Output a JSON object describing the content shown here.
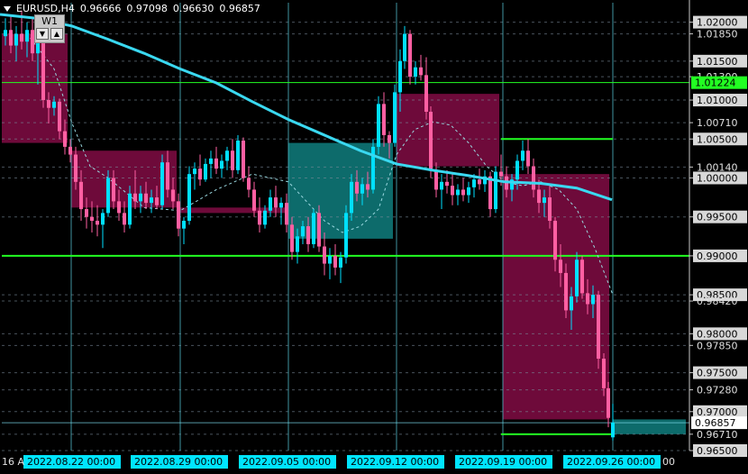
{
  "header": {
    "symbol": "EURUSD,H4",
    "open": "0.96666",
    "high": "0.97098",
    "low": "0.96630",
    "close": "0.96857"
  },
  "widget": {
    "label": "W1"
  },
  "colors": {
    "bull": "#00e0ff",
    "bear": "#ff5fa2",
    "ma": "#3ad8f0",
    "box_bear": "#6e0a3a",
    "box_bull": "#0d6b6b",
    "hline": "#22ff22",
    "grid": "#7a8b9a",
    "vline": "#4fb8c8",
    "current": "#7ad8e8"
  },
  "chart_data": {
    "type": "candlestick",
    "ylim": [
      0.965,
      1.0225
    ],
    "price_labels": [
      "1.02000",
      "1.01850",
      "1.01500",
      "1.01300",
      "1.01000",
      "1.00710",
      "1.00500",
      "1.00140",
      "1.00000",
      "0.99500",
      "0.99000",
      "0.98500",
      "0.98420",
      "0.98000",
      "0.97850",
      "0.97500",
      "0.97280",
      "0.97000",
      "0.96710",
      "0.96500"
    ],
    "horizontal_lines": [
      {
        "price": 1.01224,
        "label": "1.01224"
      },
      {
        "price": 0.99,
        "label": "0.99000"
      },
      {
        "price": 0.96857,
        "label": "0.96857"
      }
    ],
    "date_labels": [
      "2022.08.22 00:00",
      "2022.08.29 00:00",
      "2022.09.05 00:00",
      "2022.09.12 00:00",
      "2022.09.19 00:00",
      "2022.09.26 00:00"
    ],
    "edge_labels": [
      "16 A",
      "00"
    ],
    "weekly_boxes": [
      {
        "week": "2022.08.15",
        "open": 1.0185,
        "close": 1.0045,
        "type": "bear"
      },
      {
        "week": "2022.08.22",
        "open": 1.0035,
        "close": 0.9962,
        "type": "bear"
      },
      {
        "week": "2022.08.29",
        "open": 0.9962,
        "close": 0.9955,
        "type": "bear"
      },
      {
        "week": "2022.09.05",
        "open": 0.9922,
        "close": 1.0045,
        "type": "bull"
      },
      {
        "week": "2022.09.12",
        "open": 1.0108,
        "close": 1.0015,
        "type": "bear"
      },
      {
        "week": "2022.09.19",
        "open": 1.0005,
        "close": 0.969,
        "type": "bear"
      },
      {
        "week": "2022.09.26",
        "open": 0.969,
        "close": 0.9671,
        "type": "bull"
      }
    ],
    "green_segments": [
      {
        "price": 1.005,
        "from": "2022.09.19",
        "to": "2022.09.26"
      },
      {
        "price": 0.9671,
        "from": "2022.09.19",
        "to": "2022.09.26"
      }
    ],
    "ma_series": [
      [
        0,
        1.021
      ],
      [
        40,
        1.0205
      ],
      [
        80,
        1.0195
      ],
      [
        120,
        1.0178
      ],
      [
        160,
        1.016
      ],
      [
        200,
        1.014
      ],
      [
        240,
        1.0122
      ],
      [
        280,
        1.0098
      ],
      [
        320,
        1.0075
      ],
      [
        360,
        1.0055
      ],
      [
        400,
        1.0035
      ],
      [
        440,
        1.0018
      ],
      [
        480,
        1.001
      ],
      [
        520,
        1.0003
      ],
      [
        560,
        0.9995
      ],
      [
        600,
        0.9993
      ],
      [
        640,
        0.9987
      ],
      [
        679,
        0.9972
      ]
    ],
    "dashed_ma_series": [
      [
        30,
        1.0185
      ],
      [
        60,
        1.014
      ],
      [
        80,
        1.007
      ],
      [
        100,
        1.0015
      ],
      [
        120,
        1.0
      ],
      [
        160,
        0.9962
      ],
      [
        200,
        0.9958
      ],
      [
        240,
        0.9985
      ],
      [
        280,
        1.0005
      ],
      [
        320,
        0.9995
      ],
      [
        360,
        0.9945
      ],
      [
        380,
        0.993
      ],
      [
        400,
        0.9938
      ],
      [
        420,
        0.996
      ],
      [
        440,
        1.003
      ],
      [
        460,
        1.0062
      ],
      [
        480,
        1.0072
      ],
      [
        500,
        1.0068
      ],
      [
        520,
        1.0045
      ],
      [
        540,
        1.0015
      ],
      [
        560,
        0.9995
      ],
      [
        580,
        0.999
      ],
      [
        600,
        0.9995
      ],
      [
        620,
        0.9985
      ],
      [
        640,
        0.996
      ],
      [
        660,
        0.991
      ],
      [
        680,
        0.985
      ]
    ],
    "candles": [
      {
        "x": 6,
        "o": 1.0182,
        "h": 1.0205,
        "l": 1.017,
        "c": 1.019
      },
      {
        "x": 12,
        "o": 1.019,
        "h": 1.021,
        "l": 1.016,
        "c": 1.017
      },
      {
        "x": 18,
        "o": 1.017,
        "h": 1.0195,
        "l": 1.015,
        "c": 1.0185
      },
      {
        "x": 24,
        "o": 1.0185,
        "h": 1.0215,
        "l": 1.0165,
        "c": 1.0175
      },
      {
        "x": 30,
        "o": 1.0175,
        "h": 1.02,
        "l": 1.0155,
        "c": 1.019
      },
      {
        "x": 36,
        "o": 1.019,
        "h": 1.0205,
        "l": 1.015,
        "c": 1.016
      },
      {
        "x": 42,
        "o": 1.016,
        "h": 1.0185,
        "l": 1.012,
        "c": 1.0175
      },
      {
        "x": 48,
        "o": 1.0175,
        "h": 1.018,
        "l": 1.009,
        "c": 1.01
      },
      {
        "x": 54,
        "o": 1.01,
        "h": 1.011,
        "l": 1.007,
        "c": 1.009
      },
      {
        "x": 60,
        "o": 1.009,
        "h": 1.0105,
        "l": 1.008,
        "c": 1.0098
      },
      {
        "x": 66,
        "o": 1.0098,
        "h": 1.0102,
        "l": 1.005,
        "c": 1.006
      },
      {
        "x": 72,
        "o": 1.006,
        "h": 1.0075,
        "l": 1.003,
        "c": 1.004
      },
      {
        "x": 78,
        "o": 1.004,
        "h": 1.005,
        "l": 1.002,
        "c": 1.003
      },
      {
        "x": 84,
        "o": 1.003,
        "h": 1.004,
        "l": 0.9985,
        "c": 0.9995
      },
      {
        "x": 90,
        "o": 0.9995,
        "h": 1.001,
        "l": 0.9945,
        "c": 0.996
      },
      {
        "x": 96,
        "o": 0.996,
        "h": 0.9975,
        "l": 0.9935,
        "c": 0.995
      },
      {
        "x": 102,
        "o": 0.995,
        "h": 0.997,
        "l": 0.993,
        "c": 0.9945
      },
      {
        "x": 108,
        "o": 0.9945,
        "h": 0.9965,
        "l": 0.9925,
        "c": 0.994
      },
      {
        "x": 114,
        "o": 0.994,
        "h": 0.996,
        "l": 0.991,
        "c": 0.9955
      },
      {
        "x": 120,
        "o": 0.9955,
        "h": 1.001,
        "l": 0.995,
        "c": 1.0
      },
      {
        "x": 126,
        "o": 1.0,
        "h": 1.001,
        "l": 0.996,
        "c": 0.997
      },
      {
        "x": 132,
        "o": 0.997,
        "h": 0.9985,
        "l": 0.9945,
        "c": 0.9955
      },
      {
        "x": 138,
        "o": 0.9955,
        "h": 0.997,
        "l": 0.993,
        "c": 0.994
      },
      {
        "x": 144,
        "o": 0.994,
        "h": 0.999,
        "l": 0.9935,
        "c": 0.998
      },
      {
        "x": 150,
        "o": 0.998,
        "h": 1.001,
        "l": 0.996,
        "c": 0.997
      },
      {
        "x": 156,
        "o": 0.997,
        "h": 0.999,
        "l": 0.9955,
        "c": 0.998
      },
      {
        "x": 162,
        "o": 0.998,
        "h": 0.9995,
        "l": 0.996,
        "c": 0.9968
      },
      {
        "x": 168,
        "o": 0.9968,
        "h": 0.9985,
        "l": 0.9955,
        "c": 0.9975
      },
      {
        "x": 174,
        "o": 0.9975,
        "h": 0.999,
        "l": 0.996,
        "c": 0.9965
      },
      {
        "x": 180,
        "o": 0.9965,
        "h": 1.003,
        "l": 0.996,
        "c": 1.002
      },
      {
        "x": 186,
        "o": 1.002,
        "h": 1.0035,
        "l": 0.9975,
        "c": 0.9985
      },
      {
        "x": 192,
        "o": 0.9985,
        "h": 1.0,
        "l": 0.996,
        "c": 0.997
      },
      {
        "x": 198,
        "o": 0.997,
        "h": 0.998,
        "l": 0.9925,
        "c": 0.9935
      },
      {
        "x": 204,
        "o": 0.9935,
        "h": 0.995,
        "l": 0.9915,
        "c": 0.9945
      },
      {
        "x": 210,
        "o": 0.9945,
        "h": 1.0015,
        "l": 0.994,
        "c": 1.0005
      },
      {
        "x": 216,
        "o": 1.0005,
        "h": 1.002,
        "l": 0.9985,
        "c": 1.0012
      },
      {
        "x": 222,
        "o": 1.0012,
        "h": 1.003,
        "l": 0.999,
        "c": 0.9998
      },
      {
        "x": 228,
        "o": 0.9998,
        "h": 1.0025,
        "l": 0.9995,
        "c": 1.0018
      },
      {
        "x": 234,
        "o": 1.0018,
        "h": 1.0035,
        "l": 1.0,
        "c": 1.0025
      },
      {
        "x": 240,
        "o": 1.0025,
        "h": 1.004,
        "l": 1.0005,
        "c": 1.0012
      },
      {
        "x": 246,
        "o": 1.0012,
        "h": 1.003,
        "l": 1.0,
        "c": 1.0022
      },
      {
        "x": 252,
        "o": 1.0022,
        "h": 1.004,
        "l": 1.001,
        "c": 1.0035
      },
      {
        "x": 258,
        "o": 1.0035,
        "h": 1.005,
        "l": 1.0,
        "c": 1.001
      },
      {
        "x": 264,
        "o": 1.001,
        "h": 1.0055,
        "l": 1.0005,
        "c": 1.0048
      },
      {
        "x": 270,
        "o": 1.0048,
        "h": 1.0052,
        "l": 0.9995,
        "c": 1.0
      },
      {
        "x": 276,
        "o": 1.0,
        "h": 1.0015,
        "l": 0.9975,
        "c": 0.9985
      },
      {
        "x": 282,
        "o": 0.9985,
        "h": 0.9995,
        "l": 0.995,
        "c": 0.9958
      },
      {
        "x": 288,
        "o": 0.9958,
        "h": 0.9975,
        "l": 0.993,
        "c": 0.994
      },
      {
        "x": 294,
        "o": 0.994,
        "h": 0.9965,
        "l": 0.9935,
        "c": 0.9958
      },
      {
        "x": 300,
        "o": 0.9958,
        "h": 0.9985,
        "l": 0.995,
        "c": 0.9975
      },
      {
        "x": 306,
        "o": 0.9975,
        "h": 0.999,
        "l": 0.995,
        "c": 0.9962
      },
      {
        "x": 312,
        "o": 0.9962,
        "h": 0.9975,
        "l": 0.994,
        "c": 0.9968
      },
      {
        "x": 318,
        "o": 0.9968,
        "h": 0.998,
        "l": 0.993,
        "c": 0.994
      },
      {
        "x": 324,
        "o": 0.994,
        "h": 0.995,
        "l": 0.9895,
        "c": 0.9905
      },
      {
        "x": 330,
        "o": 0.9905,
        "h": 0.9935,
        "l": 0.989,
        "c": 0.9925
      },
      {
        "x": 336,
        "o": 0.9925,
        "h": 0.9945,
        "l": 0.9915,
        "c": 0.9938
      },
      {
        "x": 342,
        "o": 0.9938,
        "h": 0.995,
        "l": 0.9905,
        "c": 0.9915
      },
      {
        "x": 348,
        "o": 0.9915,
        "h": 0.996,
        "l": 0.991,
        "c": 0.9955
      },
      {
        "x": 354,
        "o": 0.9955,
        "h": 0.9965,
        "l": 0.9905,
        "c": 0.9912
      },
      {
        "x": 360,
        "o": 0.9912,
        "h": 0.993,
        "l": 0.9875,
        "c": 0.989
      },
      {
        "x": 366,
        "o": 0.989,
        "h": 0.991,
        "l": 0.987,
        "c": 0.99
      },
      {
        "x": 372,
        "o": 0.99,
        "h": 0.9915,
        "l": 0.9875,
        "c": 0.9885
      },
      {
        "x": 378,
        "o": 0.9885,
        "h": 0.9905,
        "l": 0.9865,
        "c": 0.9898
      },
      {
        "x": 384,
        "o": 0.9898,
        "h": 0.9965,
        "l": 0.989,
        "c": 0.9955
      },
      {
        "x": 390,
        "o": 0.9955,
        "h": 1.0005,
        "l": 0.9945,
        "c": 0.9995
      },
      {
        "x": 396,
        "o": 0.9995,
        "h": 1.001,
        "l": 0.997,
        "c": 0.998
      },
      {
        "x": 402,
        "o": 0.998,
        "h": 1.0,
        "l": 0.9965,
        "c": 0.9992
      },
      {
        "x": 408,
        "o": 0.9992,
        "h": 1.0008,
        "l": 0.9975,
        "c": 0.9985
      },
      {
        "x": 414,
        "o": 0.9985,
        "h": 1.005,
        "l": 0.998,
        "c": 1.004
      },
      {
        "x": 420,
        "o": 1.004,
        "h": 1.0105,
        "l": 1.003,
        "c": 1.0095
      },
      {
        "x": 426,
        "o": 1.0095,
        "h": 1.011,
        "l": 1.004,
        "c": 1.0055
      },
      {
        "x": 432,
        "o": 1.0055,
        "h": 1.006,
        "l": 1.0025,
        "c": 1.0045
      },
      {
        "x": 438,
        "o": 1.0045,
        "h": 1.012,
        "l": 1.004,
        "c": 1.011
      },
      {
        "x": 444,
        "o": 1.011,
        "h": 1.0165,
        "l": 1.0085,
        "c": 1.015
      },
      {
        "x": 449,
        "o": 1.015,
        "h": 1.0195,
        "l": 1.014,
        "c": 1.0185
      },
      {
        "x": 455,
        "o": 1.0185,
        "h": 1.019,
        "l": 1.012,
        "c": 1.013
      },
      {
        "x": 461,
        "o": 1.013,
        "h": 1.015,
        "l": 1.012,
        "c": 1.0142
      },
      {
        "x": 467,
        "o": 1.0142,
        "h": 1.0158,
        "l": 1.0125,
        "c": 1.0132
      },
      {
        "x": 473,
        "o": 1.0132,
        "h": 1.0155,
        "l": 1.0075,
        "c": 1.0085
      },
      {
        "x": 478,
        "o": 1.0085,
        "h": 1.0092,
        "l": 1.0,
        "c": 1.001
      },
      {
        "x": 484,
        "o": 1.001,
        "h": 1.002,
        "l": 0.9975,
        "c": 0.9985
      },
      {
        "x": 490,
        "o": 0.9985,
        "h": 1.0005,
        "l": 0.996,
        "c": 0.9995
      },
      {
        "x": 496,
        "o": 0.9995,
        "h": 1.001,
        "l": 0.998,
        "c": 0.999
      },
      {
        "x": 502,
        "o": 0.999,
        "h": 1.0005,
        "l": 0.9965,
        "c": 0.9978
      },
      {
        "x": 508,
        "o": 0.9978,
        "h": 0.9992,
        "l": 0.9965,
        "c": 0.9985
      },
      {
        "x": 514,
        "o": 0.9985,
        "h": 1.0,
        "l": 0.997,
        "c": 0.9978
      },
      {
        "x": 520,
        "o": 0.9978,
        "h": 0.9995,
        "l": 0.9968,
        "c": 0.9988
      },
      {
        "x": 526,
        "o": 0.9988,
        "h": 1.0005,
        "l": 0.9975,
        "c": 0.9998
      },
      {
        "x": 532,
        "o": 0.9998,
        "h": 1.0012,
        "l": 0.9985,
        "c": 0.9992
      },
      {
        "x": 538,
        "o": 0.9992,
        "h": 1.001,
        "l": 0.9982,
        "c": 1.0002
      },
      {
        "x": 544,
        "o": 1.0002,
        "h": 1.0008,
        "l": 0.995,
        "c": 0.996
      },
      {
        "x": 550,
        "o": 0.996,
        "h": 1.0015,
        "l": 0.9955,
        "c": 1.0008
      },
      {
        "x": 556,
        "o": 1.0008,
        "h": 1.003,
        "l": 0.999,
        "c": 1.0002
      },
      {
        "x": 562,
        "o": 1.0002,
        "h": 1.0015,
        "l": 0.9975,
        "c": 0.9985
      },
      {
        "x": 568,
        "o": 0.9985,
        "h": 1.0005,
        "l": 0.997,
        "c": 0.9998
      },
      {
        "x": 574,
        "o": 0.9998,
        "h": 1.003,
        "l": 0.9985,
        "c": 1.0022
      },
      {
        "x": 580,
        "o": 1.0022,
        "h": 1.0048,
        "l": 1.001,
        "c": 1.0035
      },
      {
        "x": 586,
        "o": 1.0035,
        "h": 1.005,
        "l": 1.0005,
        "c": 1.0015
      },
      {
        "x": 592,
        "o": 1.0015,
        "h": 1.0025,
        "l": 0.9975,
        "c": 0.9985
      },
      {
        "x": 598,
        "o": 0.9985,
        "h": 0.9998,
        "l": 0.9955,
        "c": 0.9968
      },
      {
        "x": 604,
        "o": 0.9968,
        "h": 0.9985,
        "l": 0.995,
        "c": 0.9975
      },
      {
        "x": 610,
        "o": 0.9975,
        "h": 0.999,
        "l": 0.9935,
        "c": 0.9945
      },
      {
        "x": 616,
        "o": 0.9945,
        "h": 0.995,
        "l": 0.988,
        "c": 0.9895
      },
      {
        "x": 622,
        "o": 0.9895,
        "h": 0.9915,
        "l": 0.986,
        "c": 0.9878
      },
      {
        "x": 628,
        "o": 0.9878,
        "h": 0.989,
        "l": 0.982,
        "c": 0.983
      },
      {
        "x": 634,
        "o": 0.983,
        "h": 0.986,
        "l": 0.9805,
        "c": 0.9848
      },
      {
        "x": 640,
        "o": 0.9848,
        "h": 0.9905,
        "l": 0.984,
        "c": 0.9895
      },
      {
        "x": 646,
        "o": 0.9895,
        "h": 0.99,
        "l": 0.9845,
        "c": 0.9852
      },
      {
        "x": 652,
        "o": 0.9852,
        "h": 0.987,
        "l": 0.9825,
        "c": 0.9838
      },
      {
        "x": 658,
        "o": 0.9838,
        "h": 0.9862,
        "l": 0.982,
        "c": 0.985
      },
      {
        "x": 664,
        "o": 0.985,
        "h": 0.9855,
        "l": 0.9755,
        "c": 0.9768
      },
      {
        "x": 670,
        "o": 0.9768,
        "h": 0.9775,
        "l": 0.972,
        "c": 0.973
      },
      {
        "x": 675,
        "o": 0.973,
        "h": 0.9738,
        "l": 0.968,
        "c": 0.9692
      },
      {
        "x": 680,
        "o": 0.9667,
        "h": 0.971,
        "l": 0.9663,
        "c": 0.9686
      }
    ]
  }
}
